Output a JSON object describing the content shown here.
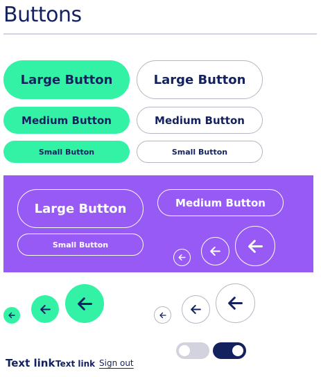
{
  "page": {
    "title": "Buttons"
  },
  "buttons": {
    "large_label": "Large Button",
    "medium_label": "Medium Button",
    "small_label": "Small Button"
  },
  "links": {
    "large": "Text link",
    "small": "Text link",
    "underlined": "Sign out"
  },
  "toggles": [
    {
      "state": "off"
    },
    {
      "state": "on"
    }
  ],
  "icons": {
    "arrow": "arrow-left-icon"
  },
  "colors": {
    "navy": "#14215f",
    "mint": "#33f2a6",
    "purple": "#985af4",
    "outline": "#b7b4c4",
    "toggle_off": "#d3d3df"
  }
}
